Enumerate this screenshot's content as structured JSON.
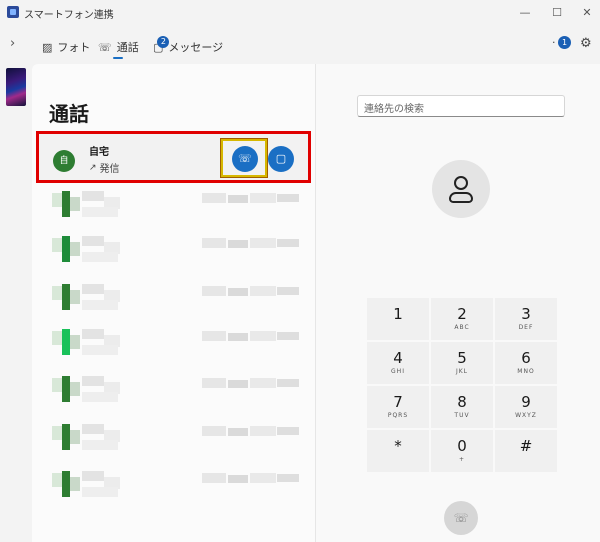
{
  "window": {
    "title": "スマートフォン連携",
    "minimize": "—",
    "maximize": "☐",
    "close": "✕"
  },
  "tabs": [
    {
      "label": "フォト",
      "icon": "photo-icon"
    },
    {
      "label": "通話",
      "icon": "phone-icon",
      "active": true
    },
    {
      "label": "メッセージ",
      "icon": "message-icon",
      "badge": "2"
    }
  ],
  "topright": {
    "notification_badge": "1",
    "settings_icon": "gear-icon"
  },
  "calls": {
    "title": "通話",
    "highlighted": {
      "avatar_text": "自",
      "name": "自宅",
      "status": "発信",
      "call_icon": "phone-icon",
      "message_icon": "message-icon"
    }
  },
  "search": {
    "placeholder": "連絡先の検索"
  },
  "dialpad": [
    {
      "digit": "1",
      "letters": ""
    },
    {
      "digit": "2",
      "letters": "ABC"
    },
    {
      "digit": "3",
      "letters": "DEF"
    },
    {
      "digit": "4",
      "letters": "GHI"
    },
    {
      "digit": "5",
      "letters": "JKL"
    },
    {
      "digit": "6",
      "letters": "MNO"
    },
    {
      "digit": "7",
      "letters": "PQRS"
    },
    {
      "digit": "8",
      "letters": "TUV"
    },
    {
      "digit": "9",
      "letters": "WXYZ"
    },
    {
      "digit": "*",
      "letters": ""
    },
    {
      "digit": "0",
      "letters": "+"
    },
    {
      "digit": "#",
      "letters": ""
    }
  ],
  "colors": {
    "accent": "#1a6fc4",
    "highlight_border": "#e00000",
    "avatar_green": "#2e7d32"
  }
}
